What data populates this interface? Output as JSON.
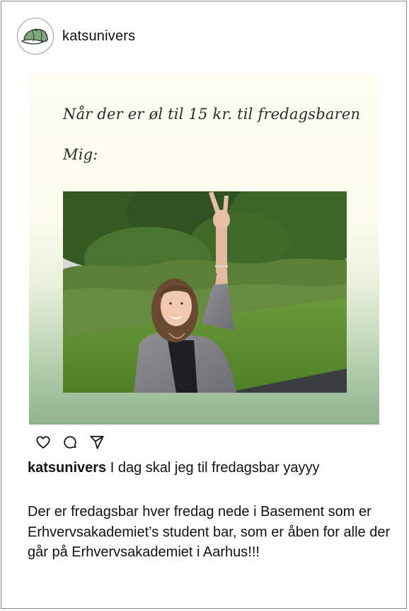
{
  "post": {
    "username": "katsunivers",
    "avatar": {
      "icon": "cap-logo-icon",
      "accent": "#7fa67f"
    },
    "image": {
      "line1": "Når der er øl til 15 kr. til fredagsbaren",
      "line2": "Mig:",
      "photo_alt": "Kvinde med hånden i vejret foran en hæk",
      "gradient": [
        "#fdfdf2",
        "#8eb28c"
      ]
    },
    "actions": [
      {
        "icon": "heart-icon",
        "label": "Synes godt om"
      },
      {
        "icon": "comment-icon",
        "label": "Kommenter"
      },
      {
        "icon": "share-icon",
        "label": "Del"
      }
    ],
    "caption": {
      "username": "katsunivers",
      "text": "I dag skal jeg til fredagsbar yayyy",
      "body": "Der er fredagsbar hver fredag nede i Basement som er Erhvervsakademiet’s student bar, som er åben for alle der går på Erhvervsakademiet i Aarhus!!!"
    }
  }
}
